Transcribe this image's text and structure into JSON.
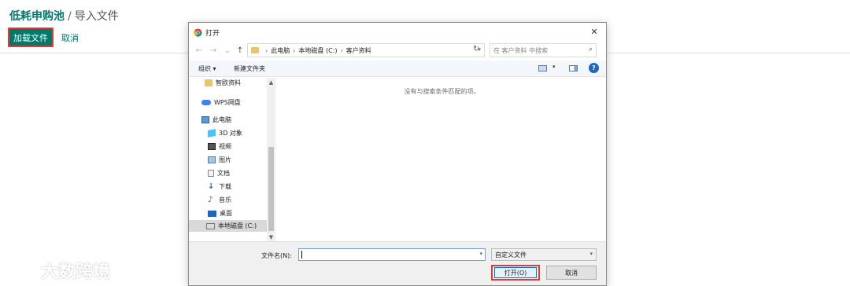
{
  "page": {
    "breadcrumb_app": "低耗申购池",
    "breadcrumb_sep": "/",
    "breadcrumb_current": "导入文件",
    "load_file_label": "加载文件",
    "cancel_label": "取消",
    "watermark": "大数跨境",
    "accent_color": "#00796b",
    "highlight_color": "#e53935"
  },
  "dialog": {
    "title": "打开",
    "close_glyph": "✕",
    "nav": {
      "back_glyph": "←",
      "forward_glyph": "→",
      "recent_glyph": "⌄",
      "up_glyph": "↑",
      "refresh_glyph": "↻"
    },
    "address": {
      "path": [
        "此电脑",
        "本地磁盘 (C:)",
        "客户资料"
      ],
      "separator": "›"
    },
    "search_placeholder": "在 客户资料 中搜索",
    "toolbar": {
      "organize": "组织 ▾",
      "new_folder": "新建文件夹",
      "help": "?"
    },
    "nav_items": [
      {
        "label": "智欧资料",
        "icon": "folder-icon"
      },
      {
        "label": "WPS网盘",
        "icon": "cloud-icon"
      },
      {
        "label": "此电脑",
        "icon": "computer-icon"
      },
      {
        "label": "3D 对象",
        "icon": "3d-objects-icon"
      },
      {
        "label": "视频",
        "icon": "video-icon"
      },
      {
        "label": "图片",
        "icon": "pictures-icon"
      },
      {
        "label": "文档",
        "icon": "documents-icon"
      },
      {
        "label": "下载",
        "icon": "download-icon"
      },
      {
        "label": "音乐",
        "icon": "music-icon"
      },
      {
        "label": "桌面",
        "icon": "desktop-icon"
      },
      {
        "label": "本地磁盘 (C:)",
        "icon": "disk-icon",
        "selected": true
      }
    ],
    "empty_message": "没有与搜索条件匹配的项。",
    "filename_label": "文件名(N):",
    "filename_value": "",
    "filter_value": "自定义文件",
    "open_label": "打开(O)",
    "cancel_label": "取消"
  }
}
